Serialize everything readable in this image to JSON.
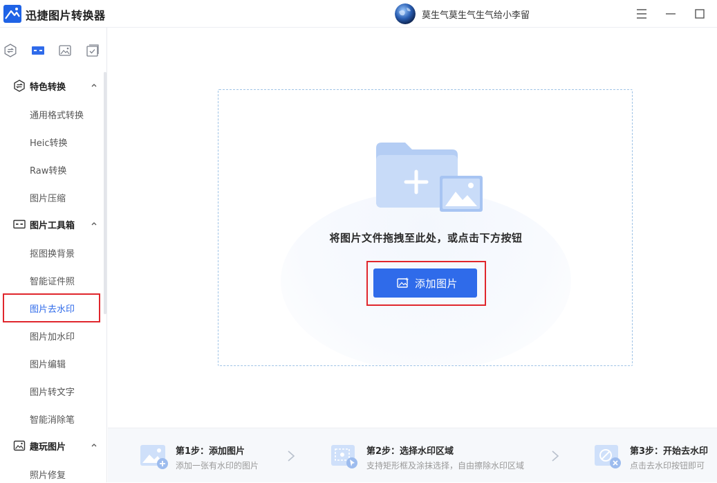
{
  "app": {
    "title": "迅捷图片转换器",
    "user_name": "莫生气莫生气生气给小李留"
  },
  "window_controls": [
    "menu-icon",
    "minimize-icon",
    "maximize-icon"
  ],
  "sidebar": {
    "tabs": [
      "convert-icon",
      "toolbox-icon",
      "image-icon",
      "checklist-icon"
    ],
    "active_tab": 1,
    "sections": [
      {
        "label": "特色转换",
        "expanded": true,
        "items": [
          "通用格式转换",
          "Heic转换",
          "Raw转换",
          "图片压缩"
        ]
      },
      {
        "label": "图片工具箱",
        "expanded": true,
        "items": [
          "抠图换背景",
          "智能证件照",
          "图片去水印",
          "图片加水印",
          "图片编辑",
          "图片转文字",
          "智能消除笔"
        ]
      },
      {
        "label": "趣玩图片",
        "expanded": true,
        "items": [
          "照片修复"
        ]
      }
    ],
    "active_item": "图片去水印"
  },
  "main": {
    "drop_text": "将图片文件拖拽至此处，或点击下方按钮",
    "add_button_label": "添加图片"
  },
  "steps": [
    {
      "title": "第1步：添加图片",
      "desc": "添加一张有水印的图片"
    },
    {
      "title": "第2步：选择水印区域",
      "desc": "支持矩形框及涂抹选择，自由擦除水印区域"
    },
    {
      "title": "第3步：开始去水印",
      "desc": "点击去水印按钮即可"
    }
  ],
  "colors": {
    "accent": "#2f6bea",
    "highlight_frame": "#e0262c",
    "dropzone_border": "#9fc3e6"
  }
}
